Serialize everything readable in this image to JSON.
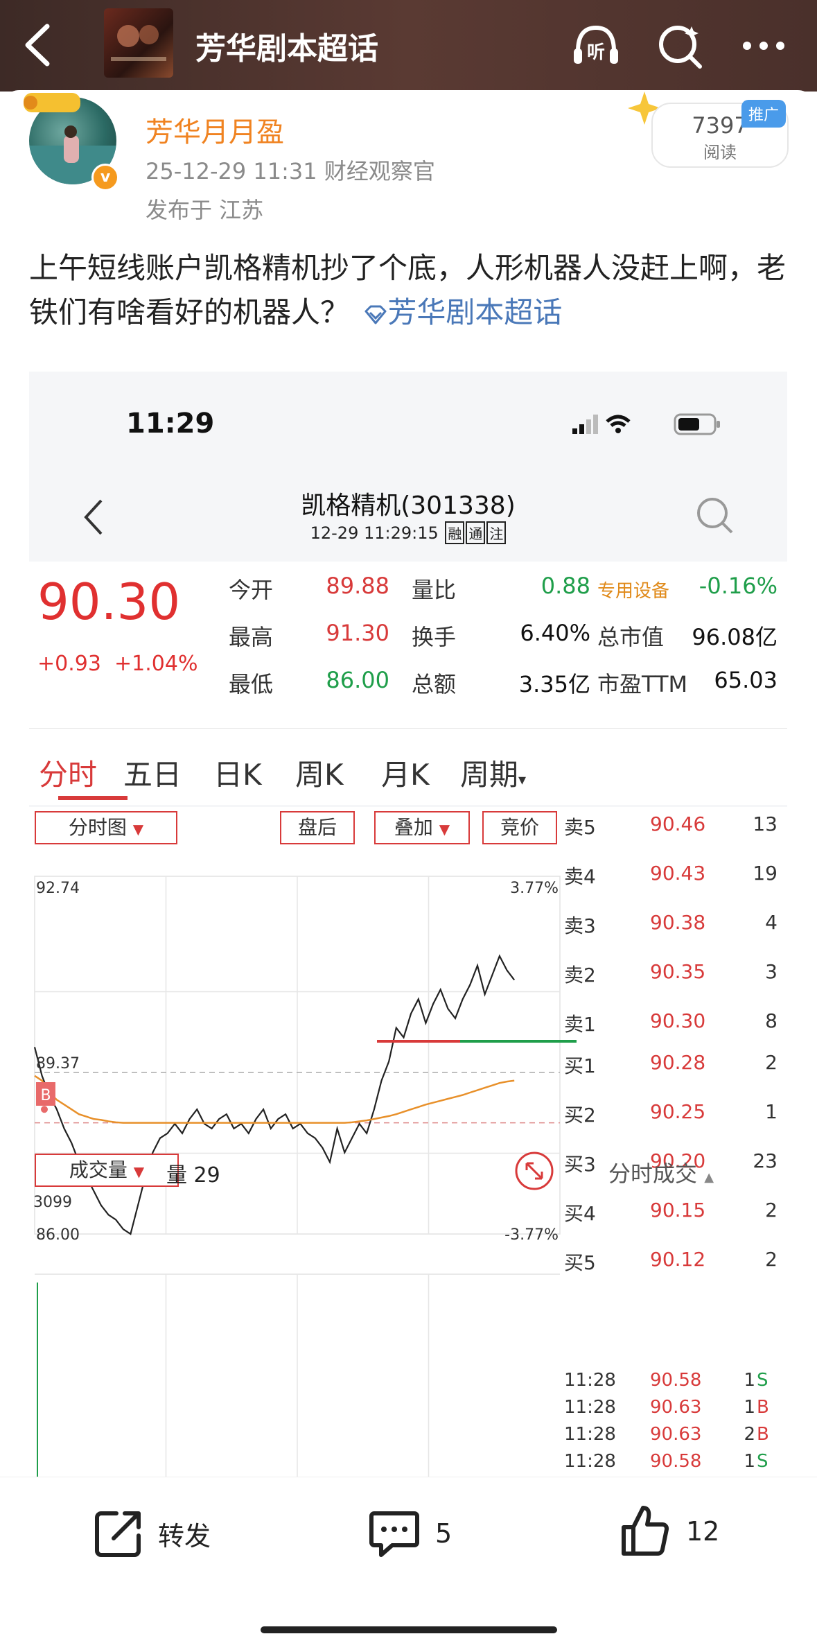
{
  "header": {
    "title": "芳华剧本超话"
  },
  "post": {
    "author": "芳华月月盈",
    "meta": "25-12-29 11:31  财经观察官",
    "location": "发布于 江苏",
    "reads": "7397",
    "reads_label": "阅读",
    "promo": "推广",
    "text": "上午短线账户凯格精机抄了个底，人形机器人没赶上啊，老铁们有啥看好的机器人？",
    "tag": "芳华剧本超话"
  },
  "shot": {
    "time": "11:29",
    "stock_name": "凯格精机(301338)",
    "datetime": "12-29 11:29:15",
    "chips": [
      "融",
      "通",
      "注"
    ],
    "price": "90.30",
    "change": "+0.93",
    "change_pct": "+1.04%",
    "quote": [
      {
        "label": "今开",
        "value": "89.88",
        "color": "red",
        "label2": "量比",
        "value2": "0.88",
        "color2": "green",
        "extra": "专用设备",
        "extra_value": "-0.16%"
      },
      {
        "label": "最高",
        "value": "91.30",
        "color": "red",
        "label2": "换手",
        "value2": "6.40%",
        "color2": "black",
        "extra": "总市值",
        "extra_value": "96.08亿"
      },
      {
        "label": "最低",
        "value": "86.00",
        "color": "green",
        "label2": "总额",
        "value2": "3.35亿",
        "color2": "black",
        "extra": "市盈TTM",
        "extra_value": "65.03"
      }
    ],
    "tabs": [
      "分时",
      "五日",
      "日K",
      "周K",
      "月K",
      "周期"
    ],
    "chart_buttons": {
      "chart": "分时图",
      "after": "盘后",
      "overlay": "叠加",
      "auction": "竞价",
      "volume": "成交量"
    },
    "axis": {
      "top": "92.74",
      "mid": "89.37",
      "bottom": "86.00",
      "top_pct": "3.77%",
      "bottom_pct": "-3.77%",
      "marker": "B"
    },
    "volume_label": "量 29",
    "volume_max": "3099",
    "order_book": {
      "asks": [
        {
          "label": "卖5",
          "price": "90.46",
          "vol": "13"
        },
        {
          "label": "卖4",
          "price": "90.43",
          "vol": "19"
        },
        {
          "label": "卖3",
          "price": "90.38",
          "vol": "4"
        },
        {
          "label": "卖2",
          "price": "90.35",
          "vol": "3"
        },
        {
          "label": "卖1",
          "price": "90.30",
          "vol": "8"
        }
      ],
      "bids": [
        {
          "label": "买1",
          "price": "90.28",
          "vol": "2"
        },
        {
          "label": "买2",
          "price": "90.25",
          "vol": "1"
        },
        {
          "label": "买3",
          "price": "90.20",
          "vol": "23"
        },
        {
          "label": "买4",
          "price": "90.15",
          "vol": "2"
        },
        {
          "label": "买5",
          "price": "90.12",
          "vol": "2"
        }
      ]
    },
    "ticks_title": "分时成交",
    "ticks": [
      {
        "time": "11:28",
        "price": "90.58",
        "vol": "1",
        "side": "S"
      },
      {
        "time": "11:28",
        "price": "90.63",
        "vol": "1",
        "side": "B"
      },
      {
        "time": "11:28",
        "price": "90.63",
        "vol": "2",
        "side": "B"
      },
      {
        "time": "11:28",
        "price": "90.58",
        "vol": "1",
        "side": "S"
      }
    ],
    "chart_data": {
      "type": "line",
      "ylim": [
        86.0,
        92.74
      ],
      "prev_close": 89.37,
      "series": [
        {
          "values": [
            89.9,
            89.3,
            88.9,
            88.6,
            88.2,
            87.9,
            87.5,
            87.2,
            86.9,
            86.6,
            86.4,
            86.3,
            86.1,
            86.0,
            86.6,
            87.2,
            87.7,
            88.0,
            88.1,
            88.3,
            88.1,
            88.4,
            88.6,
            88.3,
            88.2,
            88.4,
            88.5,
            88.2,
            88.3,
            88.1,
            88.4,
            88.6,
            88.2,
            88.4,
            88.5,
            88.2,
            88.3,
            88.1,
            88.0,
            87.8,
            87.5,
            88.2,
            87.7,
            88.0,
            88.3,
            88.1,
            88.6,
            89.2,
            89.6,
            90.3,
            90.1,
            90.6,
            90.9,
            90.4,
            90.8,
            91.1,
            90.7,
            90.5,
            90.9,
            91.2,
            91.6,
            91.0,
            91.4,
            91.8,
            91.5,
            91.3
          ]
        }
      ],
      "avg_values": [
        89.3,
        89.2,
        88.95,
        88.8,
        88.7,
        88.6,
        88.5,
        88.45,
        88.4,
        88.38,
        88.35,
        88.33,
        88.32,
        88.32,
        88.32,
        88.32,
        88.32,
        88.32,
        88.32,
        88.32,
        88.32,
        88.32,
        88.32,
        88.32,
        88.32,
        88.32,
        88.32,
        88.32,
        88.32,
        88.32,
        88.32,
        88.32,
        88.32,
        88.32,
        88.32,
        88.32,
        88.32,
        88.32,
        88.32,
        88.32,
        88.32,
        88.32,
        88.32,
        88.33,
        88.35,
        88.37,
        88.4,
        88.43,
        88.46,
        88.5,
        88.55,
        88.6,
        88.65,
        88.7,
        88.74,
        88.78,
        88.82,
        88.86,
        88.9,
        88.95,
        89.0,
        89.05,
        89.1,
        89.15,
        89.18,
        89.2
      ]
    }
  },
  "actions": {
    "share": "转发",
    "comment_count": "5",
    "like_count": "12"
  }
}
